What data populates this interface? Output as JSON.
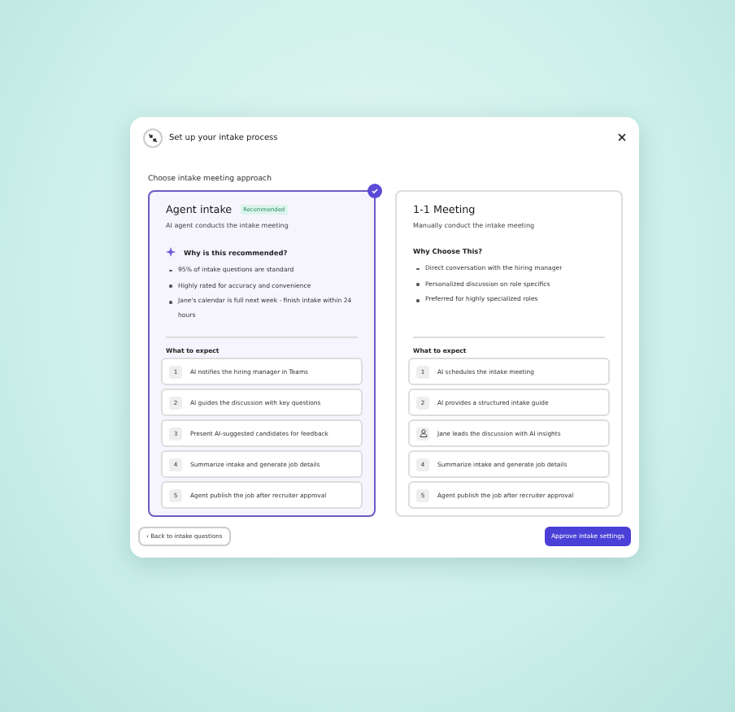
{
  "dialog": {
    "title": "Set up your intake process",
    "prompt": "Choose intake meeting approach"
  },
  "options": [
    {
      "title": "Agent intake",
      "badge": "Recommended",
      "subtitle": "AI agent conducts the intake meeting",
      "selected": true,
      "why_title": "Why is this recommended?",
      "why_icon": true,
      "reasons": [
        "95% of intake questions are standard",
        "Highly rated for accuracy and convenience",
        "Jane's calendar is full next week - finish intake within 24 hours"
      ],
      "steps_title": "What to expect",
      "steps": [
        {
          "kind": "number",
          "marker": "1",
          "text": "AI notifies the hiring manager in Teams"
        },
        {
          "kind": "number",
          "marker": "2",
          "text": "AI guides the discussion with key questions"
        },
        {
          "kind": "number",
          "marker": "3",
          "text": "Present AI-suggested candidates for feedback"
        },
        {
          "kind": "number",
          "marker": "4",
          "text": "Summarize intake and generate job details"
        },
        {
          "kind": "number",
          "marker": "5",
          "text": "Agent publish the job after recruiter approval"
        }
      ]
    },
    {
      "title": "1-1 Meeting",
      "subtitle": "Manually conduct the intake meeting",
      "selected": false,
      "why_title": "Why Choose This?",
      "why_icon": false,
      "reasons": [
        "Direct conversation with the hiring manager",
        "Personalized discussion on role specifics",
        "Preferred for highly specialized roles"
      ],
      "steps_title": "What to expect",
      "steps": [
        {
          "kind": "number",
          "marker": "1",
          "text": "AI schedules the intake meeting"
        },
        {
          "kind": "number",
          "marker": "2",
          "text": "AI provides a structured intake guide"
        },
        {
          "kind": "person",
          "text": "Jane leads the discussion with AI insights"
        },
        {
          "kind": "number",
          "marker": "4",
          "text": "Summarize intake and generate job details"
        },
        {
          "kind": "number",
          "marker": "5",
          "text": "Agent publish the job after recruiter approval"
        }
      ]
    }
  ],
  "footer": {
    "back": "‹ Back to intake questions",
    "approve": "Approve intake settings"
  }
}
